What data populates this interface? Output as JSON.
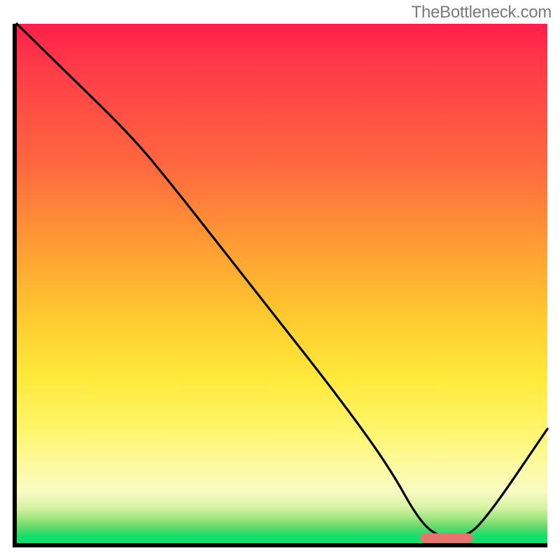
{
  "attribution": "TheBottleneck.com",
  "chart_data": {
    "type": "line",
    "title": "",
    "xlabel": "",
    "ylabel": "",
    "xlim": [
      0,
      100
    ],
    "ylim": [
      0,
      100
    ],
    "grid": false,
    "legend": false,
    "series": [
      {
        "name": "curve",
        "x": [
          0,
          10,
          22,
          30,
          40,
          50,
          60,
          70,
          76,
          80,
          84,
          88,
          100
        ],
        "y": [
          100,
          90,
          78,
          68,
          55,
          42,
          29,
          15,
          4,
          1,
          1,
          4,
          22
        ]
      }
    ],
    "marker": {
      "name": "optimal-range",
      "x_start": 76,
      "x_end": 86,
      "y": 1
    },
    "background_gradient": {
      "top": "#ff1f4b",
      "mid": "#ffe93a",
      "bottom": "#00e56c"
    }
  }
}
